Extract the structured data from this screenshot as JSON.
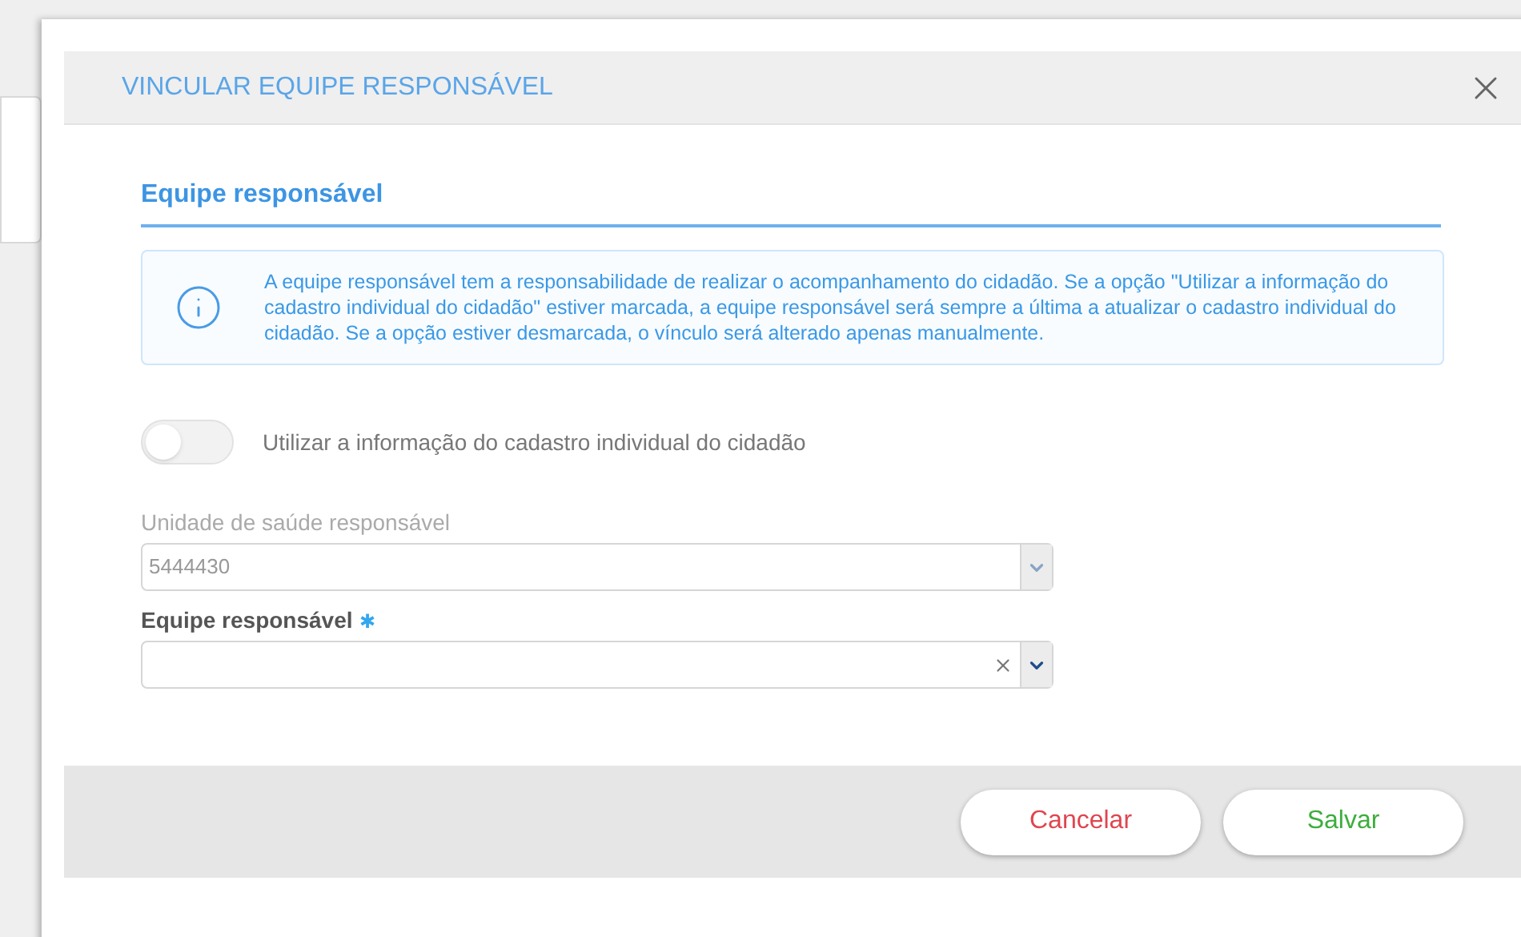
{
  "dialog": {
    "title": "VINCULAR EQUIPE RESPONSÁVEL"
  },
  "section": {
    "title": "Equipe responsável"
  },
  "info": {
    "text": "A equipe responsável tem a responsabilidade de realizar o acompanhamento do cidadão. Se a opção \"Utilizar a informação do cadastro individual do cidadão\" estiver marcada, a equipe responsável será sempre a última a atualizar o cadastro individual do cidadão. Se a opção estiver desmarcada, o vínculo será alterado apenas manualmente."
  },
  "toggle": {
    "label": "Utilizar a informação do cadastro individual do cidadão",
    "on": false
  },
  "fields": [
    {
      "label": "Unidade de saúde responsável",
      "value": "5444430",
      "disabled": true,
      "clearable": false
    },
    {
      "label": "Equipe responsável",
      "required_mark": "✱",
      "disabled": false,
      "clearable": true
    }
  ],
  "buttons": [
    {
      "label": "Cancelar",
      "kind": "cancel"
    },
    {
      "label": "Salvar",
      "kind": "confirm"
    }
  ]
}
